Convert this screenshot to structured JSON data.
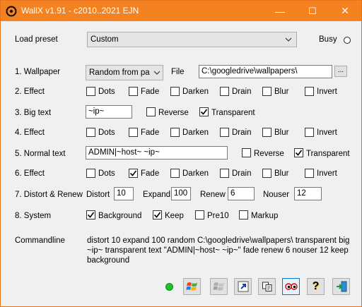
{
  "window": {
    "title": "WallX v1.91 - c2010..2021 EJN",
    "min_glyph": "—",
    "max_glyph": "☐",
    "close_glyph": "✕",
    "accent_color": "#f58220"
  },
  "preset": {
    "label": "Load preset",
    "value": "Custom",
    "busy_label": "Busy"
  },
  "rows": {
    "wallpaper": {
      "label": "1. Wallpaper",
      "mode": "Random from pa",
      "file_label": "File",
      "file_value": "C:\\googledrive\\wallpapers\\",
      "browse_label": "..."
    },
    "effect1": {
      "label": "2. Effect"
    },
    "bigtext": {
      "label": "3. Big text",
      "value": "~ip~",
      "reverse": "Reverse",
      "transparent": "Transparent"
    },
    "effect2": {
      "label": "4. Effect"
    },
    "normaltext": {
      "label": "5. Normal text",
      "value": "ADMIN|~host~ ~ip~",
      "reverse": "Reverse",
      "transparent": "Transparent"
    },
    "effect3": {
      "label": "6. Effect"
    },
    "distort": {
      "label": "7. Distort & Renew",
      "distort_label": "Distort",
      "distort_value": "10",
      "expand_label": "Expand",
      "expand_value": "100",
      "renew_label": "Renew",
      "renew_value": "6",
      "nouser_label": "Nouser",
      "nouser_value": "12"
    },
    "system": {
      "label": "8. System",
      "background": "Background",
      "keep": "Keep",
      "pre10": "Pre10",
      "markup": "Markup"
    }
  },
  "effects": [
    "Dots",
    "Fade",
    "Darken",
    "Drain",
    "Blur",
    "Invert"
  ],
  "commandline": {
    "label": "Commandline",
    "text": "distort 10 expand 100 random C:\\googledrive\\wallpapers\\ transparent big ~ip~ transparent text \"ADMIN|~host~ ~ip~\" fade renew 6 nouser 12 keep background"
  },
  "toolbar": {
    "icons": [
      "windows-logo-icon",
      "windows-logo-gray-icon",
      "shortcut-icon",
      "copy-icon",
      "preview-icon",
      "help-icon",
      "exit-icon"
    ],
    "help_glyph": "?"
  }
}
